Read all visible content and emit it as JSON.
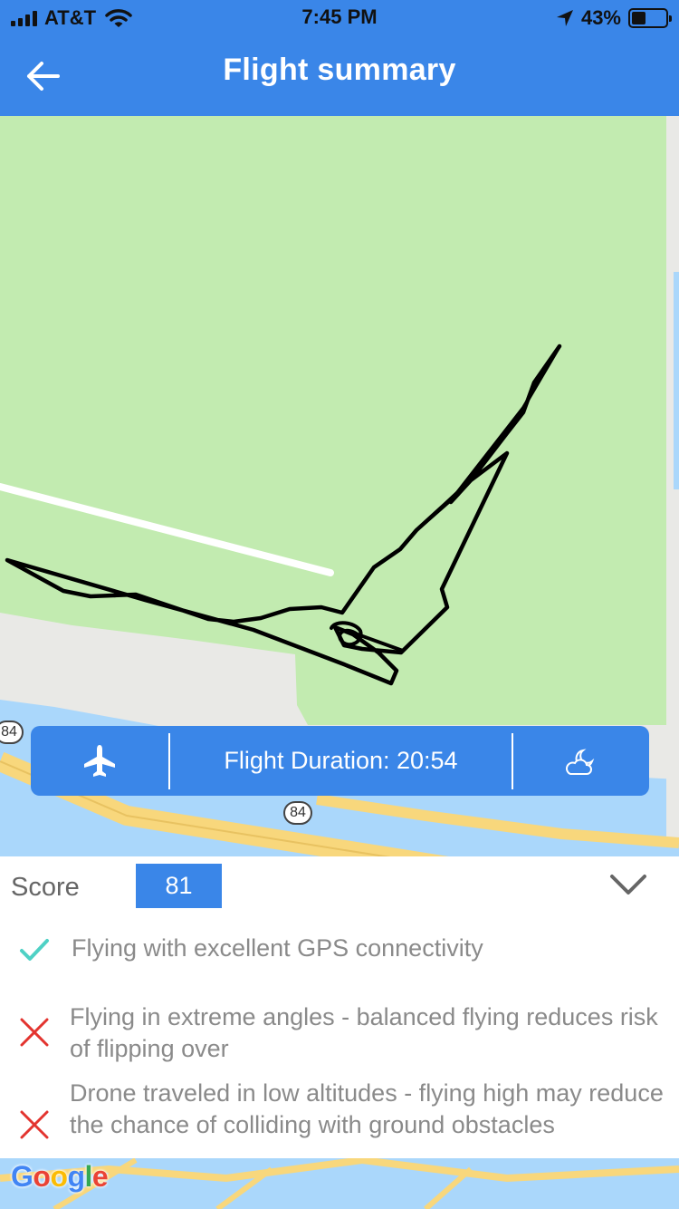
{
  "status_bar": {
    "carrier": "AT&T",
    "time": "7:45 PM",
    "battery_percent": "43%",
    "battery_level": 0.43
  },
  "header": {
    "title": "Flight summary",
    "back_icon": "arrow-left-icon"
  },
  "map": {
    "route_shields": [
      "84",
      "84"
    ],
    "attribution": {
      "letters": [
        "G",
        "o",
        "o",
        "g",
        "l",
        "e"
      ],
      "colors": [
        "#4285f4",
        "#ea4335",
        "#fbbc05",
        "#4285f4",
        "#34a853",
        "#ea4335"
      ]
    },
    "colors": {
      "park": "#c2ebb0",
      "water": "#aad7fb",
      "road": "#f8d77c",
      "land": "#e9e9e6",
      "flight_path": "#000000"
    }
  },
  "flight_bar": {
    "plane_icon": "airplane-icon",
    "duration_label": "Flight Duration: 20:54",
    "weather_icon": "cloud-moon-icon"
  },
  "score": {
    "label": "Score",
    "value": "81",
    "expand_icon": "chevron-down-icon"
  },
  "feedback": [
    {
      "status": "pass",
      "icon": "check-icon",
      "color": "#4fd1c5",
      "text": "Flying with excellent GPS connectivity"
    },
    {
      "status": "fail",
      "icon": "x-icon",
      "color": "#e3342f",
      "text": "Flying in extreme angles - balanced flying reduces risk of flipping over"
    },
    {
      "status": "fail",
      "icon": "x-icon",
      "color": "#e3342f",
      "text": "Drone traveled in low altitudes - flying high may reduce the chance of colliding with ground obstacles"
    }
  ],
  "theme": {
    "accent": "#3a86e8"
  }
}
